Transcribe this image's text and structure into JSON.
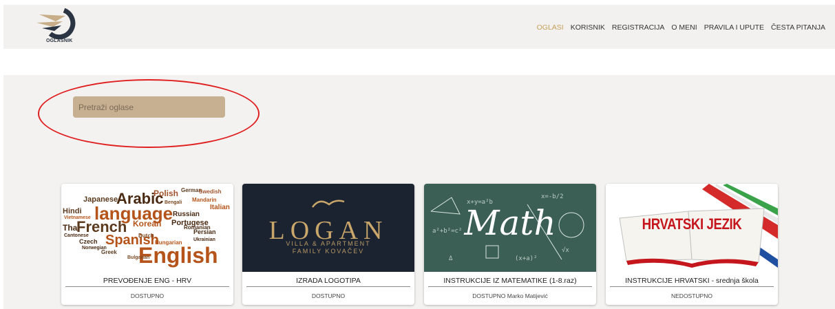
{
  "brand": {
    "name": "OGLASNIK"
  },
  "nav": {
    "items": [
      "OGLASI",
      "KORISNIK",
      "REGISTRACIJA",
      "O MENI",
      "PRAVILA I UPUTE",
      "ČESTA PITANJA"
    ],
    "active": "OGLASI"
  },
  "search": {
    "placeholder": "Pretraži oglase",
    "value": ""
  },
  "cards": [
    {
      "title": "PREVOĐENJE ENG - HRV",
      "status": "DOSTUPNO",
      "image": {
        "words": [
          "Japanese",
          "Arabic",
          "Polish",
          "German",
          "Hindi",
          "language",
          "Bengali",
          "Russian",
          "Thai",
          "French",
          "Korean",
          "Portugese",
          "Spanish",
          "Italian",
          "Mandarin",
          "Swedish",
          "Persian",
          "Czech",
          "Cantonese",
          "Hungarian",
          "English",
          "Greek",
          "Ukrainian",
          "Romanian",
          "Vietnamese",
          "Dutch",
          "Norwegian",
          "Bulgarian"
        ]
      }
    },
    {
      "title": "IZRADA LOGOTIPA",
      "status": "DOSTUPNO",
      "image": {
        "wordmark": "LOGAN",
        "line1": "VILLA & APARTMENT",
        "line2": "FAMILY KOVAČEV"
      }
    },
    {
      "title": "INSTRUKCIJE IZ MATEMATIKE (1-8.raz)",
      "status": "DOSTUPNO Marko Matijević",
      "image": {
        "word": "Math",
        "formulas": [
          "x+y=a²b",
          "x=-b/2",
          "a²+b²=c²",
          "√x",
          "(x+a)²",
          "Δ"
        ]
      }
    },
    {
      "title": "INSTRUKCIJE HRVATSKI - srednja škola",
      "status": "NEDOSTUPNO",
      "image": {
        "word": "HRVATSKI JEZIK"
      }
    }
  ]
}
